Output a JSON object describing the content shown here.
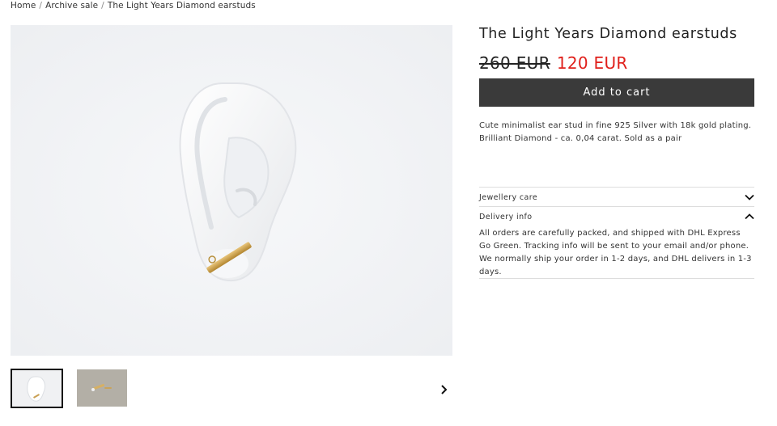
{
  "breadcrumb": {
    "items": [
      "Home",
      "Archive sale",
      "The Light Years Diamond earstuds"
    ],
    "separator": "/"
  },
  "gallery": {
    "main_image": "ear-with-gold-bar-stud",
    "thumbnails": [
      "ear-with-gold-bar-stud",
      "earstuds-on-grey"
    ],
    "next_icon": "chevron-right-icon"
  },
  "product": {
    "title": "The Light Years Diamond earstuds",
    "old_price": "260 EUR",
    "new_price": "120 EUR",
    "add_to_cart": "Add to cart",
    "description": "Cute minimalist ear stud in fine 925 Silver with 18k gold plating. Brilliant Diamond - ca. 0,04 carat. Sold as a pair",
    "accordions": [
      {
        "label": "Jewellery care",
        "expanded": false,
        "icon": "chevron-down-icon"
      },
      {
        "label": "Delivery info",
        "expanded": true,
        "icon": "chevron-up-icon",
        "body": "All orders are carefully packed, and shipped with DHL Express Go Green. Tracking info will be sent to your email and/or phone. We normally ship your order in 1-2 days, and DHL delivers in 1-3 days."
      }
    ]
  },
  "colors": {
    "sale_price": "#e0201b",
    "button_bg": "#3a3a3a",
    "divider": "#dddddd"
  }
}
